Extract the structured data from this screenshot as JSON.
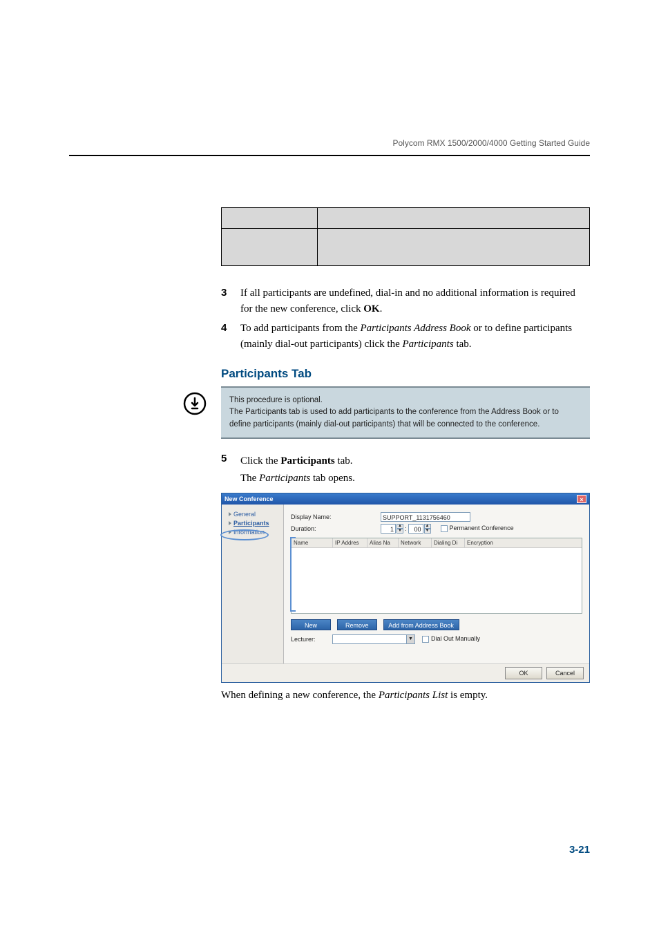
{
  "running_head": "Polycom RMX 1500/2000/4000 Getting Started Guide",
  "table": {
    "caption": ""
  },
  "steps": {
    "s3": {
      "num": "3",
      "line1": "If all participants are undefined, dial-in and no additional information is required for the new conference, click ",
      "bold": "OK",
      "tail": "."
    },
    "s4": {
      "num": "4",
      "pre": "To add participants from the ",
      "em1": "Participants Address Book",
      "mid": " or to define participants (mainly dial-out participants) click the ",
      "em2": "Participants",
      "post": " tab."
    },
    "s5": {
      "num": "5",
      "line1_pre": "Click the ",
      "line1_bold": "Participants",
      "line1_post": " tab.",
      "line2_pre": "The ",
      "line2_em": "Participants",
      "line2_post": " tab opens."
    }
  },
  "section_heading": "Participants Tab",
  "note": "This procedure is optional.\nThe Participants tab is used to add participants to the conference from the Address Book or to define participants (mainly dial-out participants) that will be connected to the conference.",
  "dialog": {
    "title": "New Conference",
    "sidebar": {
      "general": "General",
      "participants": "Participants",
      "information": "Information"
    },
    "labels": {
      "display_name": "Display Name:",
      "duration": "Duration:",
      "permanent": "Permanent Conference",
      "lecturer": "Lecturer:",
      "dial_out": "Dial Out Manually"
    },
    "values": {
      "display_name": "SUPPORT_1131756460",
      "duration_h": "1",
      "duration_m": "00"
    },
    "grid_headers": [
      "Name",
      "IP Addres",
      "Alias Na",
      "Network",
      "Dialing Di",
      "Encryption"
    ],
    "buttons": {
      "new": "New",
      "remove": "Remove",
      "add_ab": "Add from Address Book",
      "ok": "OK",
      "cancel": "Cancel"
    }
  },
  "closing": {
    "pre": "When defining a new conference, the ",
    "em": "Participants List",
    "post": " is empty."
  },
  "page_number": "3-21"
}
